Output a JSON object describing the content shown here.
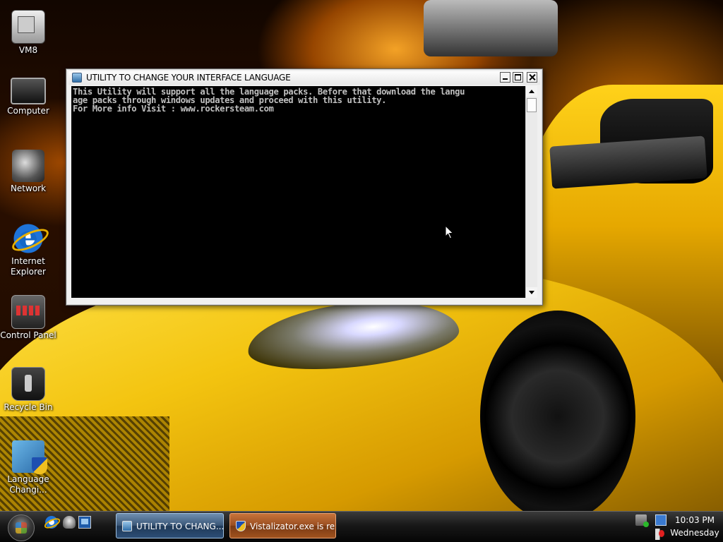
{
  "desktop": {
    "icons": [
      {
        "label": "VM8",
        "icon": "vm8-icon"
      },
      {
        "label": "Computer",
        "icon": "computer-icon"
      },
      {
        "label": "Network",
        "icon": "network-icon"
      },
      {
        "label": "Internet Explorer",
        "icon": "internet-explorer-icon"
      },
      {
        "label": "Control Panel",
        "icon": "control-panel-icon"
      },
      {
        "label": "Recycle Bin",
        "icon": "recycle-bin-icon"
      },
      {
        "label": "Language Changi...",
        "icon": "language-changer-icon"
      }
    ]
  },
  "window": {
    "title": "UTILITY TO CHANGE YOUR INTERFACE LANGUAGE",
    "console_lines": [
      "This Utility will support all the language packs. Before that download the langu",
      "age packs through windows updates and proceed with this utility.",
      "For More info Visit : www.rockersteam.com"
    ],
    "controls": {
      "minimize": "minimize",
      "maximize": "maximize",
      "close": "close"
    }
  },
  "taskbar": {
    "quick_launch": [
      "internet-explorer-icon",
      "show-desktop-icon",
      "switch-windows-icon"
    ],
    "buttons": [
      {
        "label": "UTILITY TO CHANG...",
        "active": true,
        "icon": "console-window-icon"
      },
      {
        "label": "Vistalizator.exe is re...",
        "active": false,
        "icon": "uac-shield-icon"
      }
    ],
    "tray_icons": [
      "safely-remove-hardware-icon",
      "network-status-icon",
      "volume-muted-icon"
    ],
    "clock": {
      "time": "10:03 PM",
      "day": "Wednesday"
    }
  },
  "colors": {
    "console_background": "#000000",
    "console_text": "#c0c0c0",
    "active_task": "#3b5778",
    "alert_task": "#9a4f22"
  }
}
